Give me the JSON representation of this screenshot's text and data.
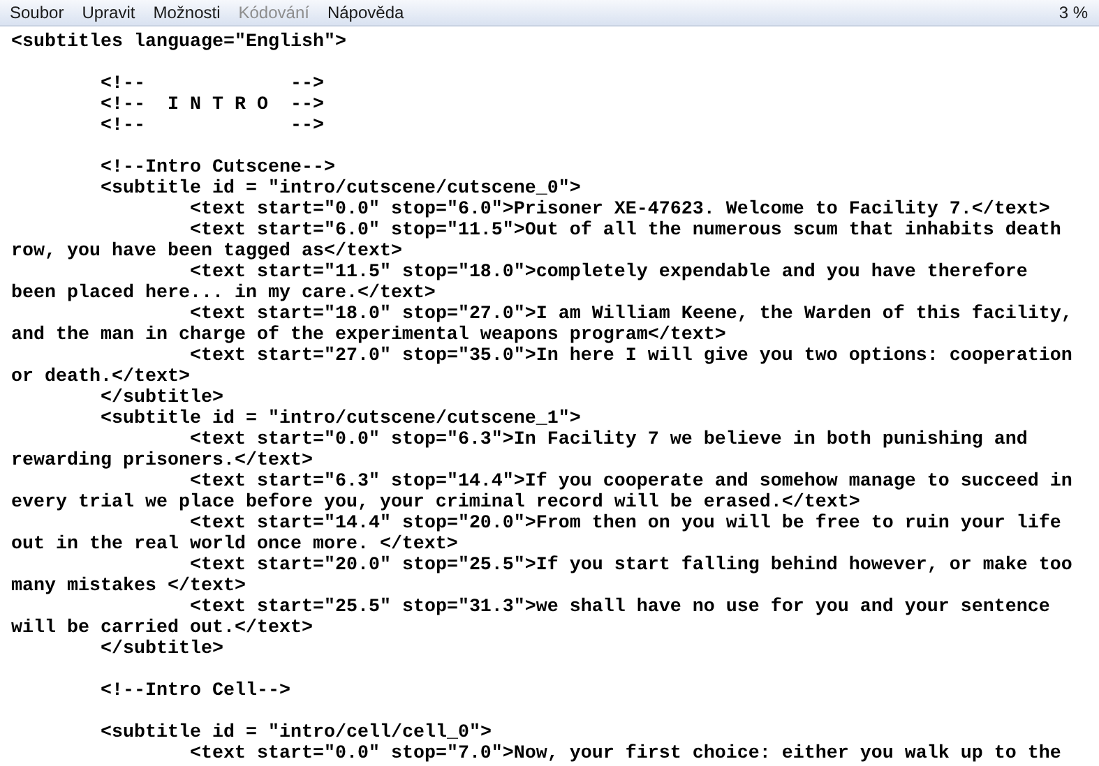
{
  "menu": [
    {
      "label": "Soubor",
      "disabled": false
    },
    {
      "label": "Upravit",
      "disabled": false
    },
    {
      "label": "Možnosti",
      "disabled": false
    },
    {
      "label": "Kódování",
      "disabled": true
    },
    {
      "label": "Nápověda",
      "disabled": false
    }
  ],
  "zoom": "3 %",
  "editor": {
    "lines": [
      {
        "kind": "text",
        "text": "<subtitles language=\"English\">"
      },
      {
        "kind": "blank"
      },
      {
        "kind": "text",
        "text": "\t<!--             -->"
      },
      {
        "kind": "text",
        "text": "\t<!--  I N T R O  -->"
      },
      {
        "kind": "text",
        "text": "\t<!--             -->"
      },
      {
        "kind": "blank"
      },
      {
        "kind": "text",
        "text": "\t<!--Intro Cutscene-->"
      },
      {
        "kind": "text",
        "text": "\t<subtitle id = \"intro/cutscene/cutscene_0\">"
      },
      {
        "kind": "text",
        "text": "\t\t<text start=\"0.0\" stop=\"6.0\">Prisoner XE-47623. Welcome to Facility 7.</text>"
      },
      {
        "kind": "text",
        "text": "\t\t<text start=\"6.0\" stop=\"11.5\">Out of all the numerous scum that inhabits death"
      },
      {
        "kind": "text",
        "text": "row, you have been tagged as</text>"
      },
      {
        "kind": "text",
        "text": "\t\t<text start=\"11.5\" stop=\"18.0\">completely expendable and you have therefore"
      },
      {
        "kind": "text",
        "text": "been placed here... in my care.</text>"
      },
      {
        "kind": "text",
        "text": "\t\t<text start=\"18.0\" stop=\"27.0\">I am William Keene, the Warden of this facility,"
      },
      {
        "kind": "text",
        "text": "and the man in charge of the experimental weapons program</text>"
      },
      {
        "kind": "text",
        "text": "\t\t<text start=\"27.0\" stop=\"35.0\">In here I will give you two options: cooperation"
      },
      {
        "kind": "text",
        "text": "or death.</text>"
      },
      {
        "kind": "text",
        "text": "\t</subtitle>"
      },
      {
        "kind": "text",
        "text": "\t<subtitle id = \"intro/cutscene/cutscene_1\">"
      },
      {
        "kind": "text",
        "text": "\t\t<text start=\"0.0\" stop=\"6.3\">In Facility 7 we believe in both punishing and"
      },
      {
        "kind": "text",
        "text": "rewarding prisoners.</text>"
      },
      {
        "kind": "text",
        "text": "\t\t<text start=\"6.3\" stop=\"14.4\">If you cooperate and somehow manage to succeed in"
      },
      {
        "kind": "text",
        "text": "every trial we place before you, your criminal record will be erased.</text>"
      },
      {
        "kind": "text",
        "text": "\t\t<text start=\"14.4\" stop=\"20.0\">From then on you will be free to ruin your life"
      },
      {
        "kind": "text",
        "text": "out in the real world once more. </text>"
      },
      {
        "kind": "text",
        "text": "\t\t<text start=\"20.0\" stop=\"25.5\">If you start falling behind however, or make too"
      },
      {
        "kind": "text",
        "text": "many mistakes </text>"
      },
      {
        "kind": "text",
        "text": "\t\t<text start=\"25.5\" stop=\"31.3\">we shall have no use for you and your sentence"
      },
      {
        "kind": "text",
        "text": "will be carried out.</text>"
      },
      {
        "kind": "text",
        "text": "\t</subtitle>"
      },
      {
        "kind": "blank"
      },
      {
        "kind": "text",
        "text": "\t<!--Intro Cell-->"
      },
      {
        "kind": "blank"
      },
      {
        "kind": "text",
        "text": "\t<subtitle id = \"intro/cell/cell_0\">"
      },
      {
        "kind": "text",
        "text": "\t\t<text start=\"0.0\" stop=\"7.0\">Now, your first choice: either you walk up to the"
      }
    ]
  }
}
